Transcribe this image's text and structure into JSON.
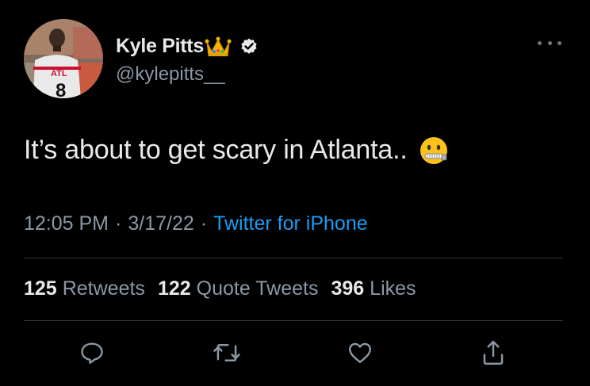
{
  "author": {
    "display_name": "Kyle Pitts",
    "handle": "@kylepitts__",
    "name_emoji": "crown-icon",
    "verified": true
  },
  "avatar": {
    "jersey_text": "ATL",
    "jersey_number": "8"
  },
  "tweet": {
    "text": "It’s about to get scary in Atlanta..",
    "trailing_emoji": "zipper-mouth-face-icon"
  },
  "meta": {
    "time": "12:05 PM",
    "separator": "·",
    "date": "3/17/22",
    "source": "Twitter for iPhone"
  },
  "stats": {
    "retweets_count": "125",
    "retweets_label": "Retweets",
    "quotes_count": "122",
    "quotes_label": "Quote Tweets",
    "likes_count": "396",
    "likes_label": "Likes"
  },
  "colors": {
    "background": "#000000",
    "primary_text": "#e7e9ea",
    "secondary_text": "#8b98a5",
    "link": "#1d9bf0",
    "divider": "#2f3336"
  },
  "actions": [
    "reply-icon",
    "retweet-icon",
    "like-icon",
    "share-icon"
  ]
}
